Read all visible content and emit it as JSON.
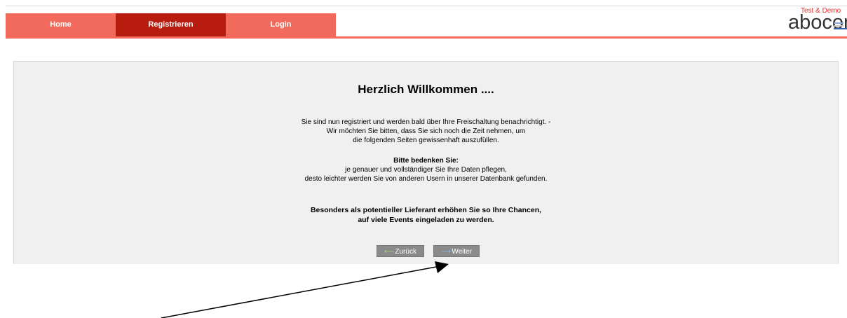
{
  "nav": {
    "items": [
      {
        "label": "Home"
      },
      {
        "label": "Registrieren"
      },
      {
        "label": "Login"
      }
    ]
  },
  "logo": {
    "top_text": "Test & Demo",
    "main_text": "abocon"
  },
  "content": {
    "title": "Herzlich Willkommen ....",
    "intro_lines": [
      "Sie sind nun registriert und werden bald über Ihre Freischaltung benachrichtigt. -",
      "Wir möchten Sie bitten, dass Sie sich noch die Zeit nehmen, um",
      "die folgenden Seiten gewissenhaft auszufüllen."
    ],
    "note_heading": "Bitte bedenken Sie:",
    "note_lines": [
      "je genauer und vollständiger Sie Ihre Daten pflegen,",
      "desto leichter werden Sie von anderen Usern in unserer Datenbank gefunden."
    ],
    "highlight_lines": [
      "Besonders als potentieller Lieferant erhöhen Sie so Ihre Chancen,",
      "auf viele Events eingeladen zu werden."
    ]
  },
  "buttons": {
    "back_label": "Zurück",
    "next_label": "Weiter"
  },
  "colors": {
    "nav": "#f26a5c",
    "nav_active": "#b81c0e",
    "button": "#8a8a8a"
  }
}
